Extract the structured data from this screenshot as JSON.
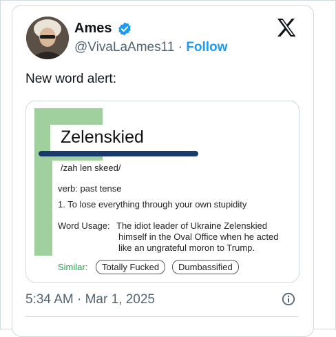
{
  "author": {
    "name": "Ames",
    "handle": "@VivaLaAmes11",
    "separator": "·",
    "follow_label": "Follow",
    "verified_color": "#1d9bf0"
  },
  "tweet": {
    "text": "New word alert:",
    "timestamp": "5:34 AM · Mar 1, 2025"
  },
  "image": {
    "word": "Zelenskied",
    "pronunciation": "/zah len skeed/",
    "part_of_speech": "verb: past tense",
    "definition": "1. To lose everything through your own stupidity",
    "usage_label": "Word Usage:",
    "usage_lines": [
      "The idiot leader of Ukraine Zelenskied",
      "himself in the Oval Office when he acted",
      "like an ungrateful moron to Trump."
    ],
    "similar_label": "Similar:",
    "similar_words": [
      "Totally Fucked",
      "Dumbassified"
    ],
    "colors": {
      "green_bar": "#9fd09d",
      "blue_line": "#183b6b",
      "similar": "#27a24a"
    }
  },
  "icons": {
    "platform_logo": "x-logo-icon",
    "verified": "verified-badge-icon",
    "info": "info-icon"
  }
}
